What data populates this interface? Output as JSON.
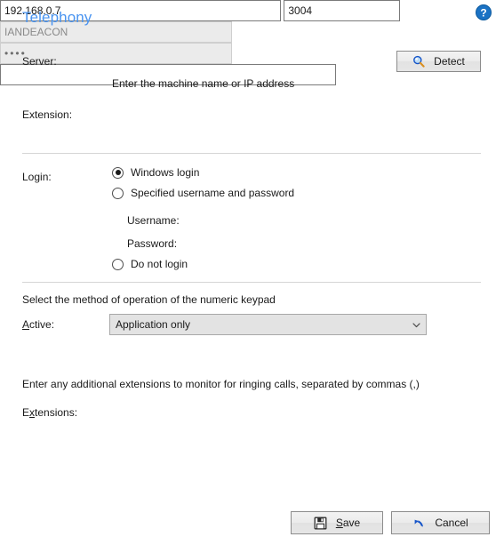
{
  "page": {
    "title": "Telephony",
    "help_icon": "help-circle-icon"
  },
  "server": {
    "label": "Server:",
    "value": "192.168.0.7",
    "hint": "Enter the machine name or IP address",
    "detect_button": "Detect",
    "detect_icon": "magnifier-icon"
  },
  "extension": {
    "label": "Extension:",
    "value": "3004"
  },
  "login": {
    "label": "Login:",
    "options": [
      {
        "label": "Windows login",
        "selected": true
      },
      {
        "label": "Specified username and password",
        "selected": false
      },
      {
        "label": "Do not login",
        "selected": false
      }
    ],
    "username": {
      "label": "Username:",
      "value": "IANDEACON",
      "disabled": true
    },
    "password": {
      "label": "Password:",
      "value": "••••",
      "masked_length": 4,
      "disabled": true
    }
  },
  "keypad": {
    "description": "Select the method of operation of the numeric keypad",
    "label": "Active:",
    "label_accesskey": "A",
    "selected": "Application only",
    "options": [
      "Application only"
    ],
    "arrow_icon": "chevron-down-icon"
  },
  "extensions": {
    "description": "Enter any additional extensions to monitor for ringing calls, separated by commas (,)",
    "label": "Extensions:",
    "label_accesskey": "x",
    "value": "",
    "placeholder": ""
  },
  "footer": {
    "save_label": "Save",
    "save_accesskey": "S",
    "save_icon": "floppy-disk-save-icon",
    "cancel_label": "Cancel",
    "cancel_icon": "undo-arrow-icon"
  },
  "colors": {
    "title_blue": "#4a94f0",
    "help_blue": "#1b72c4",
    "icon_blue": "#1554c8",
    "separator": "#d6d6d6",
    "disabled_field_bg": "#ebebeb",
    "combo_bg": "#e3e3e3"
  }
}
